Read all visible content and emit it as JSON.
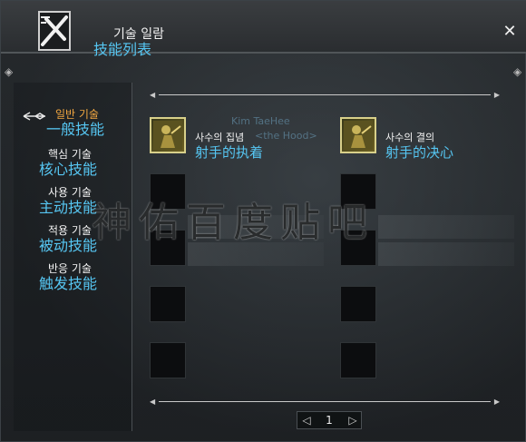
{
  "window": {
    "title_ko": "기술 일람",
    "title_cn": "技能列表",
    "close_glyph": "✕"
  },
  "nav": {
    "items": [
      {
        "label_ko": "일반 기술",
        "label_cn": "一般技能",
        "active": true
      },
      {
        "label_ko": "핵심 기술",
        "label_cn": "核心技能",
        "active": false
      },
      {
        "label_ko": "사용 기술",
        "label_cn": "主动技能",
        "active": false
      },
      {
        "label_ko": "적용 기술",
        "label_cn": "被动技能",
        "active": false
      },
      {
        "label_ko": "반응 기술",
        "label_cn": "触发技能",
        "active": false
      }
    ]
  },
  "skills": [
    {
      "name_ko": "사수의 집념",
      "name_cn": "射手的执着",
      "icon": "archer-skill-icon"
    },
    {
      "name_ko": "사수의 결의",
      "name_cn": "射手的决心",
      "icon": "archer-skill-icon"
    }
  ],
  "overlay": {
    "watermark": "神佑百度贴吧",
    "faint_line1": "Kim TaeHee",
    "faint_line2": "<the Hood>"
  },
  "pager": {
    "current_page": "1",
    "prev_glyph": "◁",
    "next_glyph": "▷"
  },
  "colors": {
    "accent_blue": "#56c6f2",
    "active_orange": "#f0a640",
    "text_white": "#f4f4f4"
  }
}
